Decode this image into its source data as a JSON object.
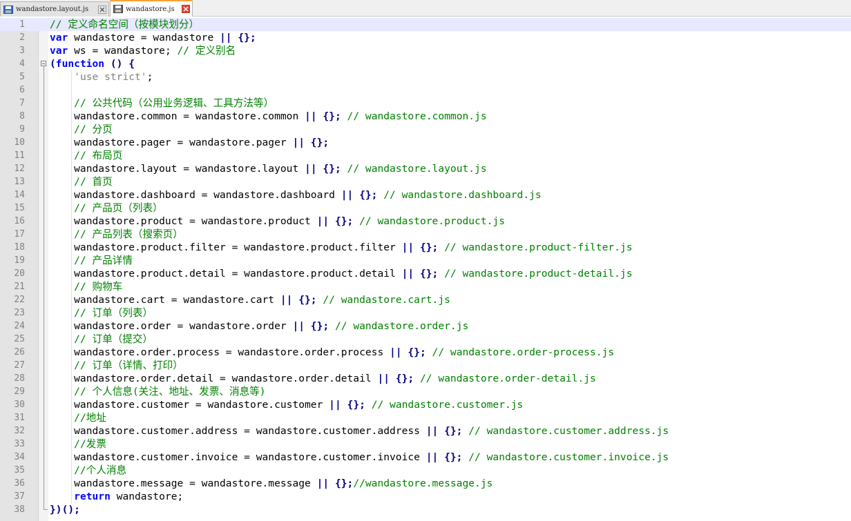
{
  "tabs": [
    {
      "name": "wandastore.layout.js",
      "active": false
    },
    {
      "name": "wandastore.js",
      "active": true
    }
  ],
  "editor": {
    "current_line": 1,
    "lines": [
      [
        {
          "t": "cm",
          "v": "// 定义命名空间（按模块划分）"
        }
      ],
      [
        {
          "t": "kw",
          "v": "var"
        },
        {
          "t": "id",
          "v": " wandastore = wandastore "
        },
        {
          "t": "op",
          "v": "|| {};"
        }
      ],
      [
        {
          "t": "kw",
          "v": "var"
        },
        {
          "t": "id",
          "v": " ws = wandastore; "
        },
        {
          "t": "cm",
          "v": "// 定义别名"
        }
      ],
      [
        {
          "t": "op",
          "v": "("
        },
        {
          "t": "kw",
          "v": "function"
        },
        {
          "t": "op",
          "v": " () {"
        }
      ],
      [
        {
          "t": "id",
          "v": "    "
        },
        {
          "t": "str",
          "v": "'use strict'"
        },
        {
          "t": "id",
          "v": ";"
        }
      ],
      [],
      [
        {
          "t": "id",
          "v": "    "
        },
        {
          "t": "cm",
          "v": "// 公共代码（公用业务逻辑、工具方法等）"
        }
      ],
      [
        {
          "t": "id",
          "v": "    wandastore.common = wandastore.common "
        },
        {
          "t": "op",
          "v": "|| {};"
        },
        {
          "t": "id",
          "v": " "
        },
        {
          "t": "cm",
          "v": "// wandastore.common.js"
        }
      ],
      [
        {
          "t": "id",
          "v": "    "
        },
        {
          "t": "cm",
          "v": "// 分页"
        }
      ],
      [
        {
          "t": "id",
          "v": "    wandastore.pager = wandastore.pager "
        },
        {
          "t": "op",
          "v": "|| {};"
        }
      ],
      [
        {
          "t": "id",
          "v": "    "
        },
        {
          "t": "cm",
          "v": "// 布局页"
        }
      ],
      [
        {
          "t": "id",
          "v": "    wandastore.layout = wandastore.layout "
        },
        {
          "t": "op",
          "v": "|| {};"
        },
        {
          "t": "id",
          "v": " "
        },
        {
          "t": "cm",
          "v": "// wandastore.layout.js"
        }
      ],
      [
        {
          "t": "id",
          "v": "    "
        },
        {
          "t": "cm",
          "v": "// 首页"
        }
      ],
      [
        {
          "t": "id",
          "v": "    wandastore.dashboard = wandastore.dashboard "
        },
        {
          "t": "op",
          "v": "|| {};"
        },
        {
          "t": "id",
          "v": " "
        },
        {
          "t": "cm",
          "v": "// wandastore.dashboard.js"
        }
      ],
      [
        {
          "t": "id",
          "v": "    "
        },
        {
          "t": "cm",
          "v": "// 产品页（列表）"
        }
      ],
      [
        {
          "t": "id",
          "v": "    wandastore.product = wandastore.product "
        },
        {
          "t": "op",
          "v": "|| {};"
        },
        {
          "t": "id",
          "v": " "
        },
        {
          "t": "cm",
          "v": "// wandastore.product.js"
        }
      ],
      [
        {
          "t": "id",
          "v": "    "
        },
        {
          "t": "cm",
          "v": "// 产品列表（搜索页）"
        }
      ],
      [
        {
          "t": "id",
          "v": "    wandastore.product.filter = wandastore.product.filter "
        },
        {
          "t": "op",
          "v": "|| {};"
        },
        {
          "t": "id",
          "v": " "
        },
        {
          "t": "cm",
          "v": "// wandastore.product-filter.js"
        }
      ],
      [
        {
          "t": "id",
          "v": "    "
        },
        {
          "t": "cm",
          "v": "// 产品详情"
        }
      ],
      [
        {
          "t": "id",
          "v": "    wandastore.product.detail = wandastore.product.detail "
        },
        {
          "t": "op",
          "v": "|| {};"
        },
        {
          "t": "id",
          "v": " "
        },
        {
          "t": "cm",
          "v": "// wandastore.product-detail.js"
        }
      ],
      [
        {
          "t": "id",
          "v": "    "
        },
        {
          "t": "cm",
          "v": "// 购物车"
        }
      ],
      [
        {
          "t": "id",
          "v": "    wandastore.cart = wandastore.cart "
        },
        {
          "t": "op",
          "v": "|| {};"
        },
        {
          "t": "id",
          "v": " "
        },
        {
          "t": "cm",
          "v": "// wandastore.cart.js"
        }
      ],
      [
        {
          "t": "id",
          "v": "    "
        },
        {
          "t": "cm",
          "v": "// 订单（列表）"
        }
      ],
      [
        {
          "t": "id",
          "v": "    wandastore.order = wandastore.order "
        },
        {
          "t": "op",
          "v": "|| {};"
        },
        {
          "t": "id",
          "v": " "
        },
        {
          "t": "cm",
          "v": "// wandastore.order.js"
        }
      ],
      [
        {
          "t": "id",
          "v": "    "
        },
        {
          "t": "cm",
          "v": "// 订单（提交）"
        }
      ],
      [
        {
          "t": "id",
          "v": "    wandastore.order.process = wandastore.order.process "
        },
        {
          "t": "op",
          "v": "|| {};"
        },
        {
          "t": "id",
          "v": " "
        },
        {
          "t": "cm",
          "v": "// wandastore.order-process.js"
        }
      ],
      [
        {
          "t": "id",
          "v": "    "
        },
        {
          "t": "cm",
          "v": "// 订单（详情、打印）"
        }
      ],
      [
        {
          "t": "id",
          "v": "    wandastore.order.detail = wandastore.order.detail "
        },
        {
          "t": "op",
          "v": "|| {};"
        },
        {
          "t": "id",
          "v": " "
        },
        {
          "t": "cm",
          "v": "// wandastore.order-detail.js"
        }
      ],
      [
        {
          "t": "id",
          "v": "    "
        },
        {
          "t": "cm",
          "v": "// 个人信息(关注、地址、发票、消息等)"
        }
      ],
      [
        {
          "t": "id",
          "v": "    wandastore.customer = wandastore.customer "
        },
        {
          "t": "op",
          "v": "|| {};"
        },
        {
          "t": "id",
          "v": " "
        },
        {
          "t": "cm",
          "v": "// wandastore.customer.js"
        }
      ],
      [
        {
          "t": "id",
          "v": "    "
        },
        {
          "t": "cm",
          "v": "//地址"
        }
      ],
      [
        {
          "t": "id",
          "v": "    wandastore.customer.address = wandastore.customer.address "
        },
        {
          "t": "op",
          "v": "|| {};"
        },
        {
          "t": "id",
          "v": " "
        },
        {
          "t": "cm",
          "v": "// wandastore.customer.address.js"
        }
      ],
      [
        {
          "t": "id",
          "v": "    "
        },
        {
          "t": "cm",
          "v": "//发票"
        }
      ],
      [
        {
          "t": "id",
          "v": "    wandastore.customer.invoice = wandastore.customer.invoice "
        },
        {
          "t": "op",
          "v": "|| {};"
        },
        {
          "t": "id",
          "v": " "
        },
        {
          "t": "cm",
          "v": "// wandastore.customer.invoice.js"
        }
      ],
      [
        {
          "t": "id",
          "v": "    "
        },
        {
          "t": "cm",
          "v": "//个人消息"
        }
      ],
      [
        {
          "t": "id",
          "v": "    wandastore.message = wandastore.message "
        },
        {
          "t": "op",
          "v": "|| {};"
        },
        {
          "t": "cm",
          "v": "//wandastore.message.js"
        }
      ],
      [
        {
          "t": "id",
          "v": "    "
        },
        {
          "t": "kw",
          "v": "return"
        },
        {
          "t": "id",
          "v": " wandastore;"
        }
      ],
      [
        {
          "t": "op",
          "v": "})();"
        }
      ]
    ]
  }
}
